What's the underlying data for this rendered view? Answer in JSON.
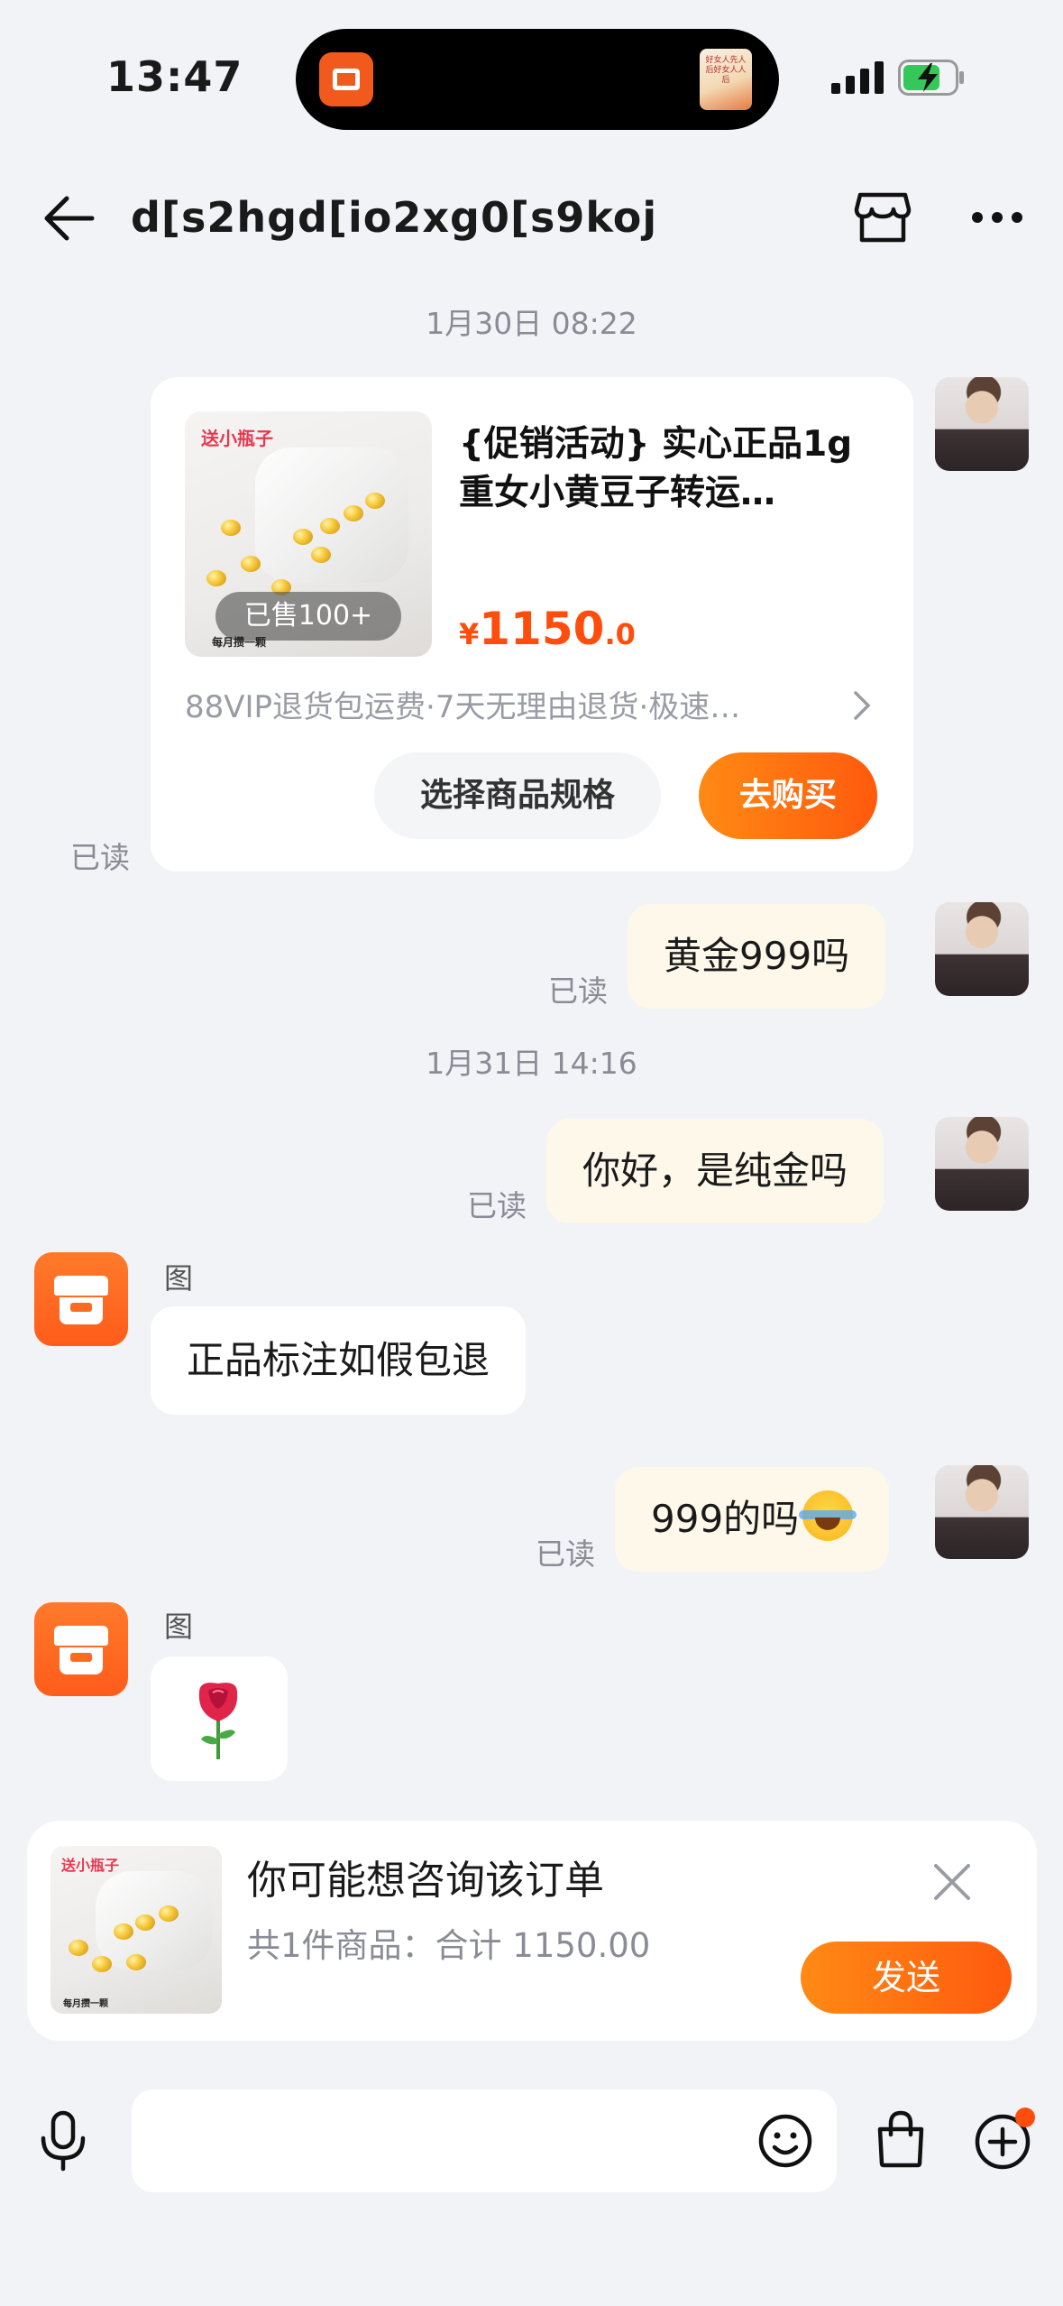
{
  "status_bar": {
    "time": "13:47",
    "island_book_text": "好女人先人后好女人人后"
  },
  "header": {
    "title": "d[s2hgd[io2xg0[s9koj"
  },
  "timestamps": [
    "1月30日 08:22",
    "1月31日 14:16"
  ],
  "product_card": {
    "image_tag": "送小瓶子",
    "sold_badge": "已售100+",
    "image_strip": "每月攒一颗",
    "title": "{促销活动} 实心正品1g重女小黄豆子转运…",
    "price_currency": "¥",
    "price_integer": "1150",
    "price_decimal": ".0",
    "service": "88VIP退货包运费·7天无理由退货·极速…",
    "spec_button": "选择商品规格",
    "buy_button": "去购买",
    "read_status": "已读"
  },
  "messages": [
    {
      "direction": "out",
      "text": "黄金999吗",
      "read": "已读"
    },
    {
      "direction": "out",
      "text": "你好，是纯金吗",
      "read": "已读"
    },
    {
      "direction": "in",
      "sender": "图",
      "text": "正品标注如假包退"
    },
    {
      "direction": "out",
      "text": "999的吗",
      "emoji": "laughing-tears",
      "read": "已读"
    },
    {
      "direction": "in",
      "sender": "图",
      "sticker": "rose"
    }
  ],
  "order_suggestion": {
    "image_tag": "送小瓶子",
    "image_strip": "每月攒一颗",
    "title": "你可能想咨询该订单",
    "summary": "共1件商品：合计 1150.00",
    "send_button": "发送"
  },
  "input_bar": {
    "placeholder": ""
  },
  "colors": {
    "accent": "#ff5a0e",
    "outgoing_bubble": "#fdf8ea",
    "background": "#f2f3f7"
  }
}
